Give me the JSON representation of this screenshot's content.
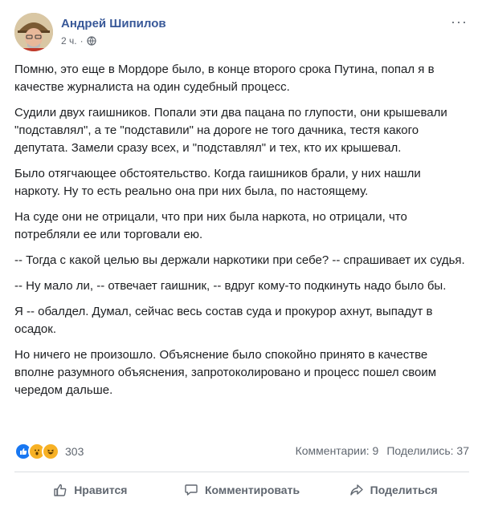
{
  "post": {
    "author": "Андрей Шипилов",
    "time": "2 ч.",
    "paragraphs": [
      "Помню, это еще в Мордоре было, в конце второго срока Путина, попал я в качестве журналиста на один судебный процесс.",
      "Судили двух гаишников. Попали эти два пацана по глупости, они крышевали \"подставлял\", а те \"подставили\" на дороге не того дачника, тестя какого депутата. Замели сразу всех, и \"подставлял\" и тех, кто их крышевал.",
      "Было отягчающее обстоятельство. Когда гаишников брали, у них нашли наркоту. Ну то есть реально она при них была, по настоящему.",
      "На суде они не отрицали, что при них была наркота, но отрицали, что потребляли ее или торговали ею.",
      "-- Тогда с какой целью вы держали наркотики при себе? -- спрашивает их судья.",
      "-- Ну мало ли, -- отвечает гаишник, -- вдруг кому-то подкинуть надо было бы.",
      "Я -- обалдел. Думал, сейчас весь состав суда и прокурор ахнут, выпадут в осадок.",
      "Но ничего не произошло. Объяснение было спокойно принято в качестве вполне разумного объяснения, запротоколировано и процесс пошел своим чередом дальше."
    ]
  },
  "stats": {
    "reaction_count": "303",
    "comments": "Комментарии: 9",
    "shares": "Поделились: 37"
  },
  "actions": {
    "like": "Нравится",
    "comment": "Комментировать",
    "share": "Поделиться"
  },
  "icons": {
    "privacy": "globe-icon",
    "more": "ellipsis-icon",
    "reactions": [
      "like-reaction-icon",
      "wow-reaction-icon",
      "haha-reaction-icon"
    ]
  },
  "colors": {
    "author": "#385898",
    "like_blue": "#1877f2",
    "emoji_yellow": "#f7b125",
    "muted": "#606770"
  }
}
